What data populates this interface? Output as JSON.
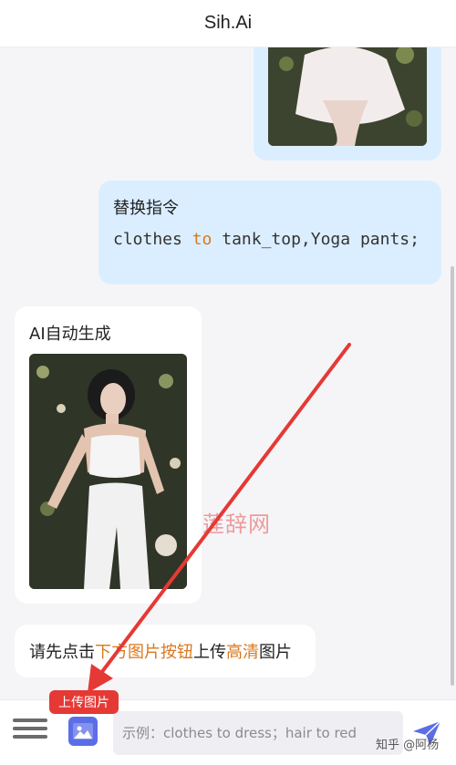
{
  "header": {
    "title": "Sih.Ai"
  },
  "messages": {
    "command": {
      "title": "替换指令",
      "code_pre": "clothes ",
      "code_kw": "to",
      "code_post": " tank_top,Yoga pants;"
    },
    "ai": {
      "title": "AI自动生成"
    },
    "hint": {
      "part1": "请先点击",
      "part2": "下方图片按钮",
      "part3": "上传",
      "part4": "高清",
      "part5": "图片"
    }
  },
  "watermark": "莲辞网",
  "tooltip": {
    "label": "上传图片"
  },
  "input": {
    "placeholder": "示例：clothes to dress；hair to red"
  },
  "credit": "知乎 @阿杨",
  "colors": {
    "user_bubble": "#dbeeff",
    "highlight": "#d9781e",
    "accent": "#5b6ee8",
    "arrow": "#e53935"
  }
}
